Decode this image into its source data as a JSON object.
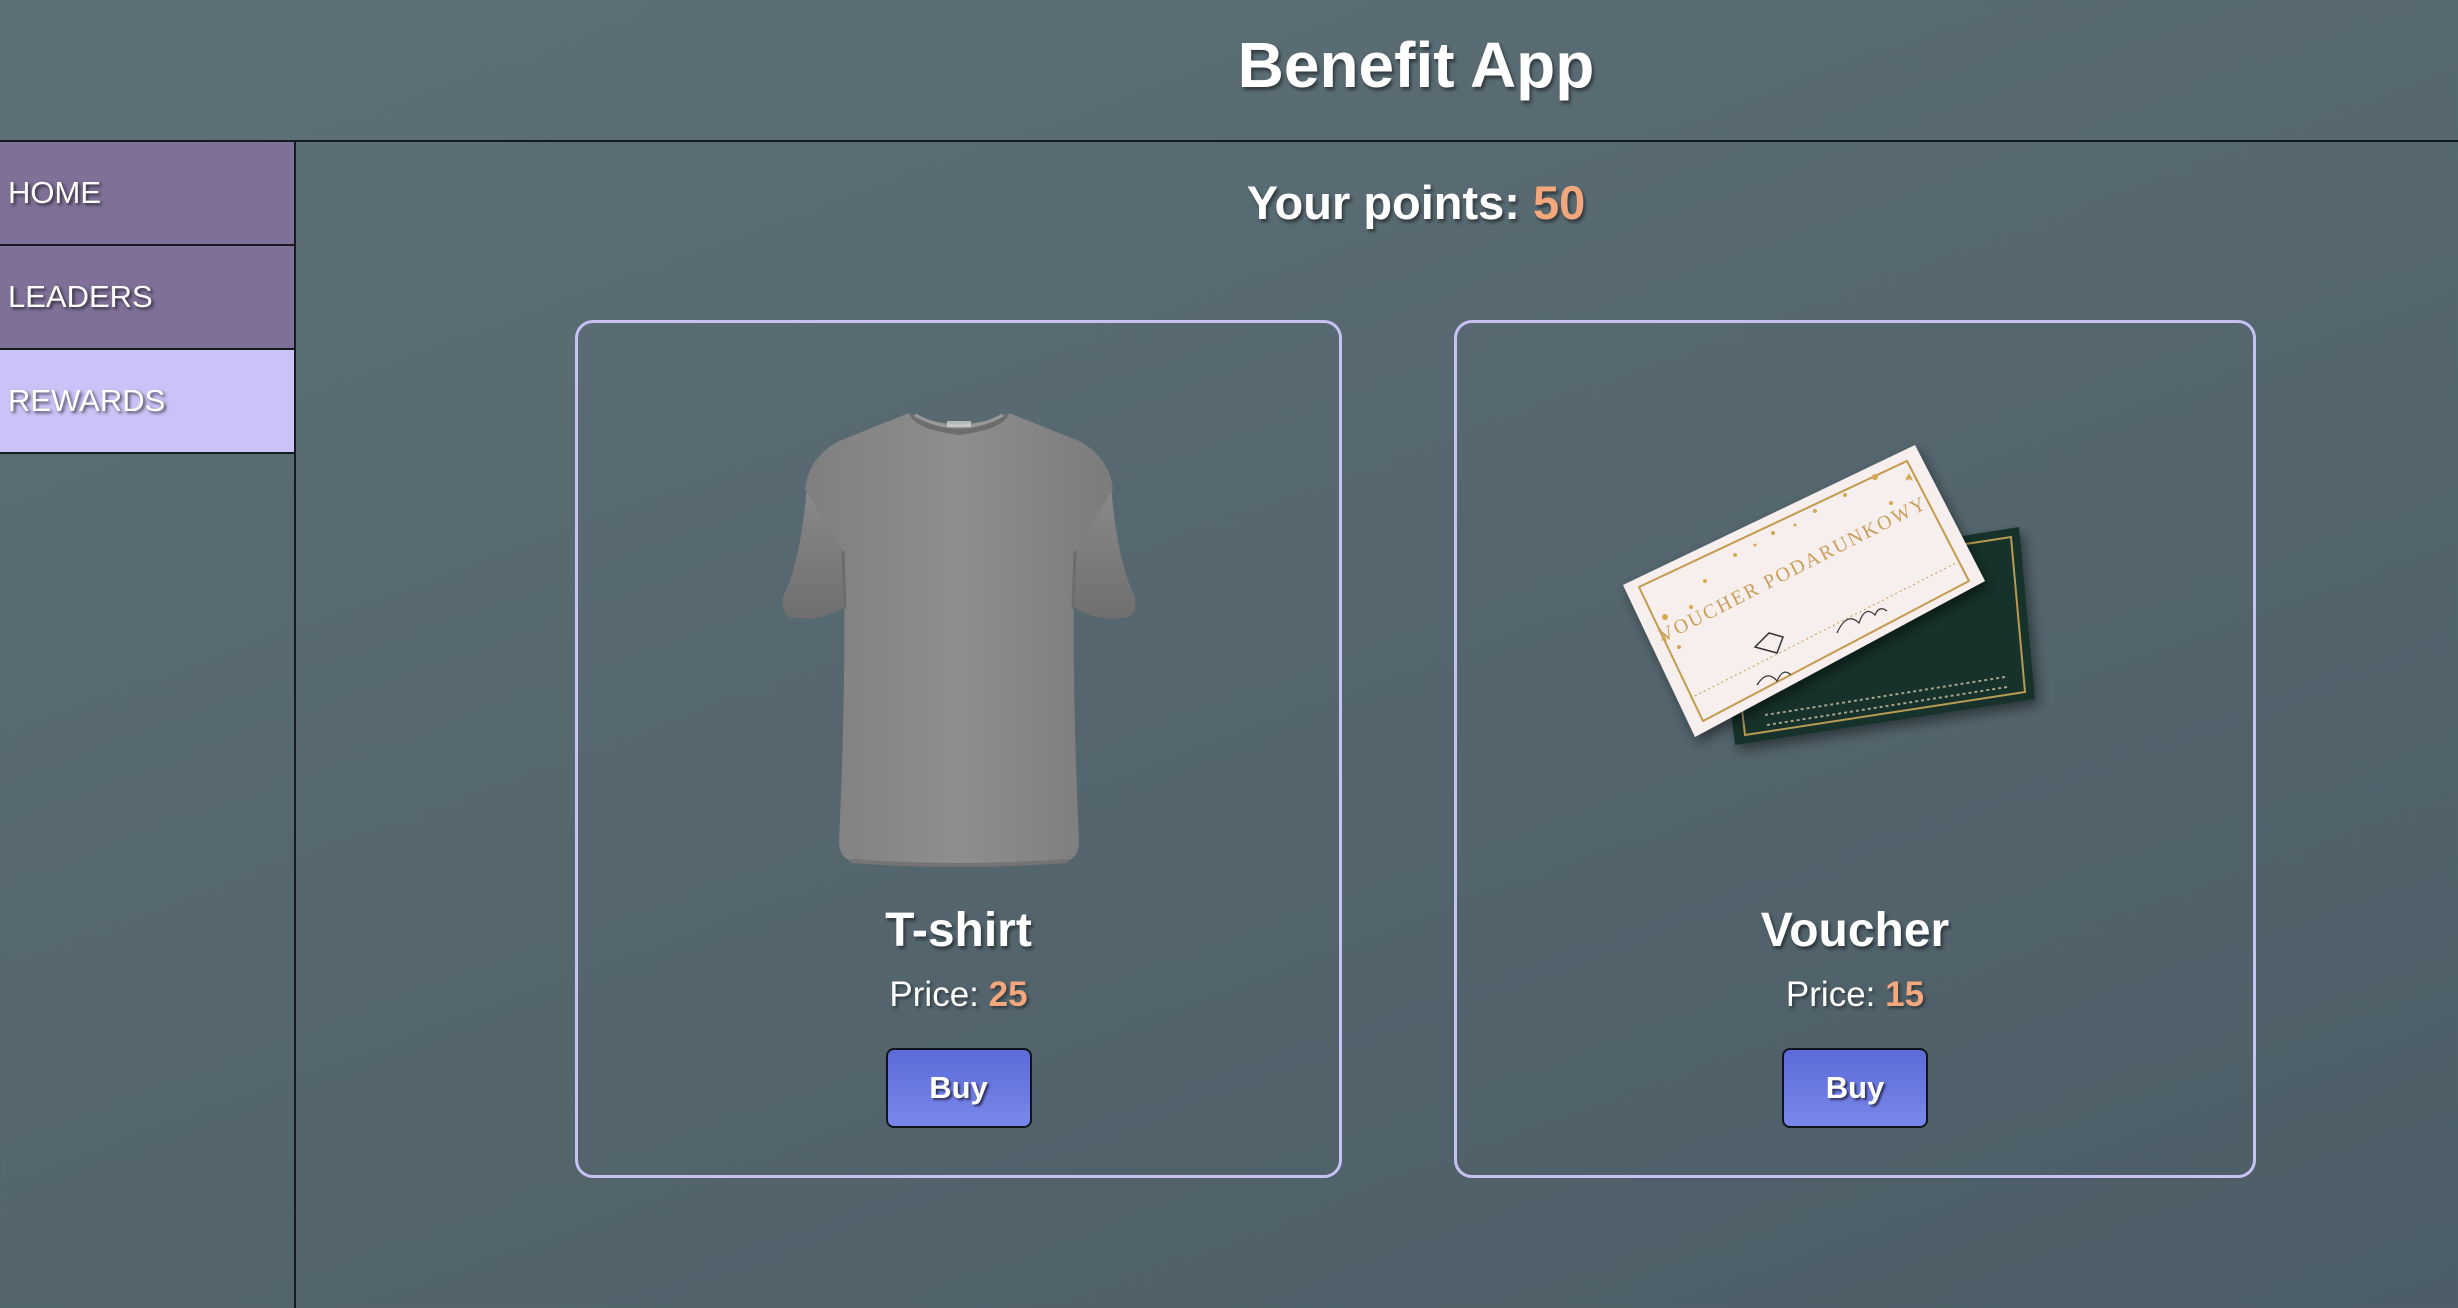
{
  "header": {
    "title": "Benefit App"
  },
  "sidebar": {
    "items": [
      {
        "label": "HOME",
        "active": false
      },
      {
        "label": "LEADERS",
        "active": false
      },
      {
        "label": "REWARDS",
        "active": true
      }
    ]
  },
  "points": {
    "label": "Your points: ",
    "value": "50"
  },
  "products": [
    {
      "name": "T-shirt",
      "price_label": "Price: ",
      "price": "25",
      "buy_label": "Buy",
      "image": "grey-tshirt"
    },
    {
      "name": "Voucher",
      "price_label": "Price: ",
      "price": "15",
      "buy_label": "Buy",
      "image": "gift-voucher",
      "image_text": "VOUCHER PODARUNKOWY"
    }
  ],
  "colors": {
    "background": "#56676f",
    "accent": "#f3a77c",
    "sidebar_item": "#7f7098",
    "sidebar_active": "#cbc3f7",
    "card_border": "#c7c1f4",
    "button": "#6a78e2"
  }
}
